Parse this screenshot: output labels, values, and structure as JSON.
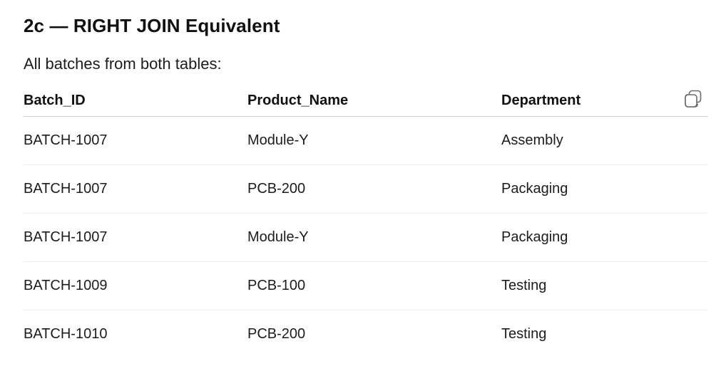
{
  "heading": "2c — RIGHT JOIN Equivalent",
  "intro": "All batches from both tables:",
  "table": {
    "columns": [
      "Batch_ID",
      "Product_Name",
      "Department"
    ],
    "rows": [
      [
        "BATCH-1007",
        "Module-Y",
        "Assembly"
      ],
      [
        "BATCH-1007",
        "PCB-200",
        "Packaging"
      ],
      [
        "BATCH-1007",
        "Module-Y",
        "Packaging"
      ],
      [
        "BATCH-1009",
        "PCB-100",
        "Testing"
      ],
      [
        "BATCH-1010",
        "PCB-200",
        "Testing"
      ]
    ]
  },
  "icons": {
    "copy": "copy-icon"
  },
  "colors": {
    "header_border": "#cfcfcf",
    "row_border": "#ebebeb",
    "icon": "#6b6b6b"
  }
}
